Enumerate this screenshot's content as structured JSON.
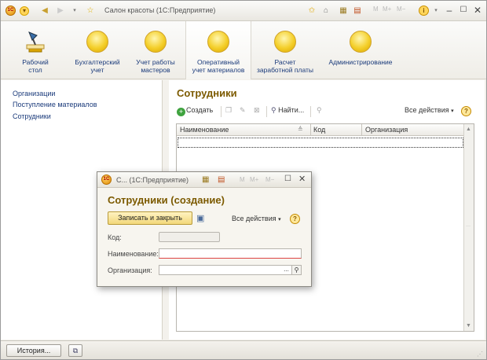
{
  "window": {
    "title": "Салон красоты  (1С:Предприятие)",
    "m_buttons": [
      "M",
      "M+",
      "M−"
    ]
  },
  "sections": [
    {
      "label": "Рабочий\nстол",
      "icon": "desk-lamp-icon"
    },
    {
      "label": "Бухгалтерский\nучет",
      "icon": "section-icon"
    },
    {
      "label": "Учет работы\nмастеров",
      "icon": "section-icon"
    },
    {
      "label": "Оперативный\nучет материалов",
      "icon": "section-icon"
    },
    {
      "label": "Расчет\nзаработной платы",
      "icon": "section-icon"
    },
    {
      "label": "Администрирование",
      "icon": "section-icon"
    }
  ],
  "nav": {
    "items": [
      "Организации",
      "Поступление материалов",
      "Сотрудники"
    ]
  },
  "list": {
    "title": "Сотрудники",
    "create_label": "Создать",
    "find_label": "Найти...",
    "all_actions_label": "Все действия",
    "help_label": "?",
    "columns": [
      "Наименование",
      "Код",
      "Организация"
    ]
  },
  "dialog": {
    "title": "С... (1С:Предприятие)",
    "m_buttons": [
      "M",
      "M+",
      "M−"
    ],
    "heading": "Сотрудники (создание)",
    "save_close_label": "Записать и закрыть",
    "all_actions_label": "Все действия",
    "help_label": "?",
    "fields": {
      "code_label": "Код:",
      "name_label": "Наименование:",
      "org_label": "Организация:",
      "org_select_label": "...",
      "code_value": "",
      "name_value": "",
      "org_value": ""
    }
  },
  "status": {
    "history_label": "История..."
  },
  "colors": {
    "heading": "#7c5a00",
    "link": "#1a3a7a",
    "accent": "#f2d77a"
  }
}
